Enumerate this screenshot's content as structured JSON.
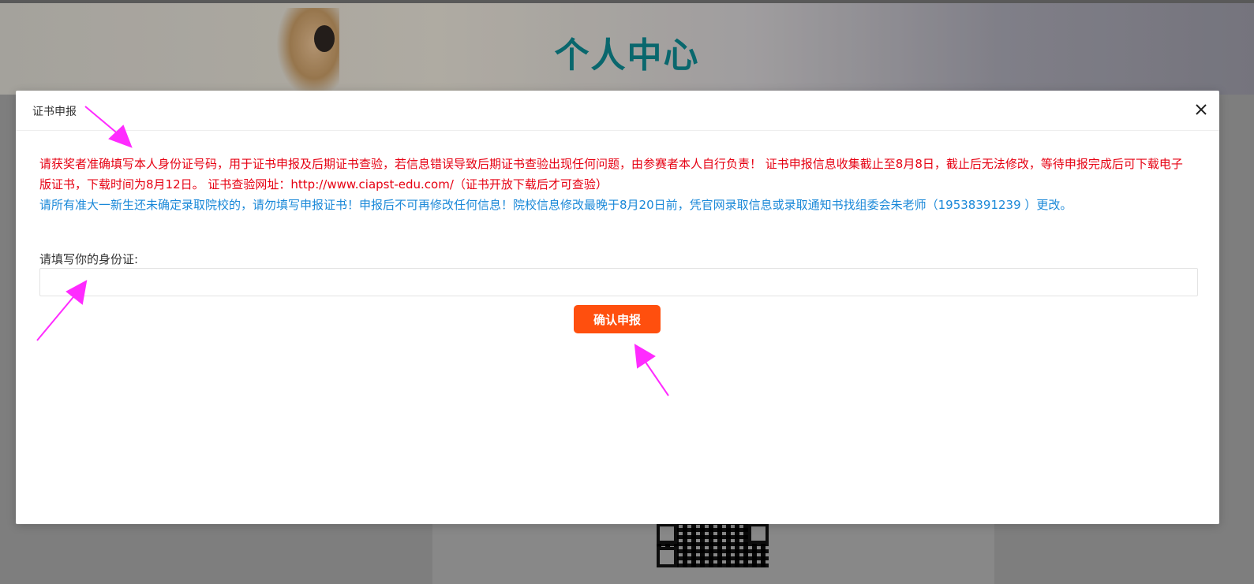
{
  "banner": {
    "title": "个人中心"
  },
  "modal": {
    "title": "证书申报",
    "notice_red": "请获奖者准确填写本人身份证号码，用于证书申报及后期证书查验，若信息错误导致后期证书查验出现任何问题，由参赛者本人自行负责！ 证书申报信息收集截止至8月8日，截止后无法修改，等待申报完成后可下载电子版证书，下载时间为8月12日。 证书查验网址：http://www.ciapst-edu.com/（证书开放下载后才可查验）",
    "notice_blue": "请所有准大一新生还未确定录取院校的，请勿填写申报证书！申报后不可再修改任何信息！院校信息修改最晚于8月20日前，凭官网录取信息或录取通知书找组委会朱老师（19538391239 ）更改。",
    "field_label": "请填写你的身份证:",
    "id_input": {
      "value": "",
      "placeholder": ""
    },
    "confirm_label": "确认申报"
  },
  "colors": {
    "title_teal": "#0c7e86",
    "notice_red": "#e60012",
    "notice_blue": "#1a88d8",
    "button_orange": "#ff4f0e",
    "annotation_magenta": "#ff2bff"
  },
  "icons": {
    "close": "close-icon",
    "qr": "qr-code"
  }
}
